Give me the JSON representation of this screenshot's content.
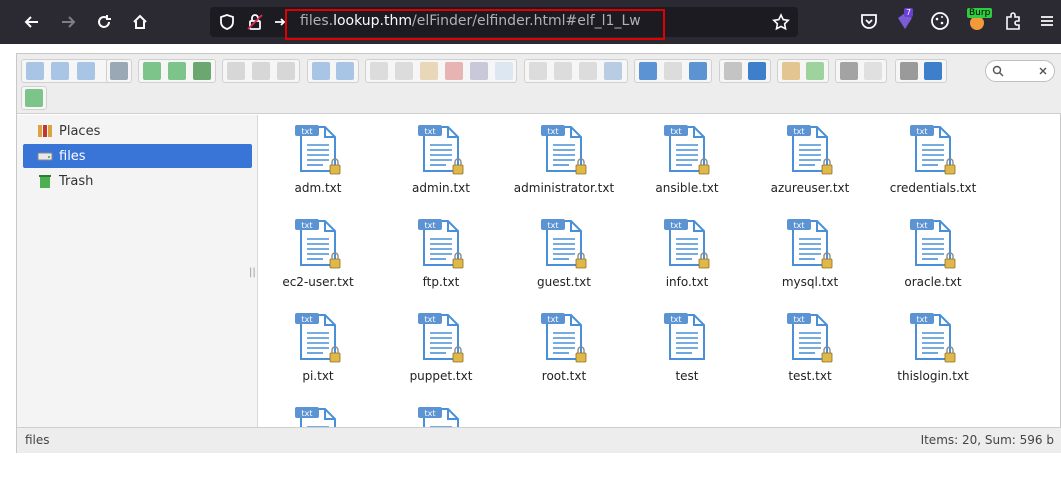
{
  "browser": {
    "url_host_prefix": "files.",
    "url_host_main": "lookup.thm",
    "url_path": "/elFinder/elfinder.html#elf_l1_Lw",
    "extension_badge": "7",
    "burp_label": "Burp"
  },
  "sidebar": {
    "items": [
      {
        "label": "Places"
      },
      {
        "label": "files"
      },
      {
        "label": "Trash"
      }
    ]
  },
  "files": [
    {
      "name": "adm.txt",
      "locked": true
    },
    {
      "name": "admin.txt",
      "locked": true
    },
    {
      "name": "administrator.txt",
      "locked": true
    },
    {
      "name": "ansible.txt",
      "locked": true
    },
    {
      "name": "azureuser.txt",
      "locked": true
    },
    {
      "name": "credentials.txt",
      "locked": true
    },
    {
      "name": "ec2-user.txt",
      "locked": true
    },
    {
      "name": "ftp.txt",
      "locked": true
    },
    {
      "name": "guest.txt",
      "locked": true
    },
    {
      "name": "info.txt",
      "locked": true
    },
    {
      "name": "mysql.txt",
      "locked": true
    },
    {
      "name": "oracle.txt",
      "locked": true
    },
    {
      "name": "pi.txt",
      "locked": true
    },
    {
      "name": "puppet.txt",
      "locked": true
    },
    {
      "name": "root.txt",
      "locked": true
    },
    {
      "name": "test",
      "locked": false
    },
    {
      "name": "test.txt",
      "locked": true
    },
    {
      "name": "thislogin.txt",
      "locked": true
    },
    {
      "name": "",
      "locked": true
    },
    {
      "name": "",
      "locked": true
    }
  ],
  "file_icon_tag": "txt",
  "status": {
    "path": "files",
    "info": "Items: 20, Sum: 596 b"
  },
  "colors": {
    "selection": "#3875d7",
    "icon_blue": "#4a90d9",
    "url_highlight": "#e00000"
  }
}
